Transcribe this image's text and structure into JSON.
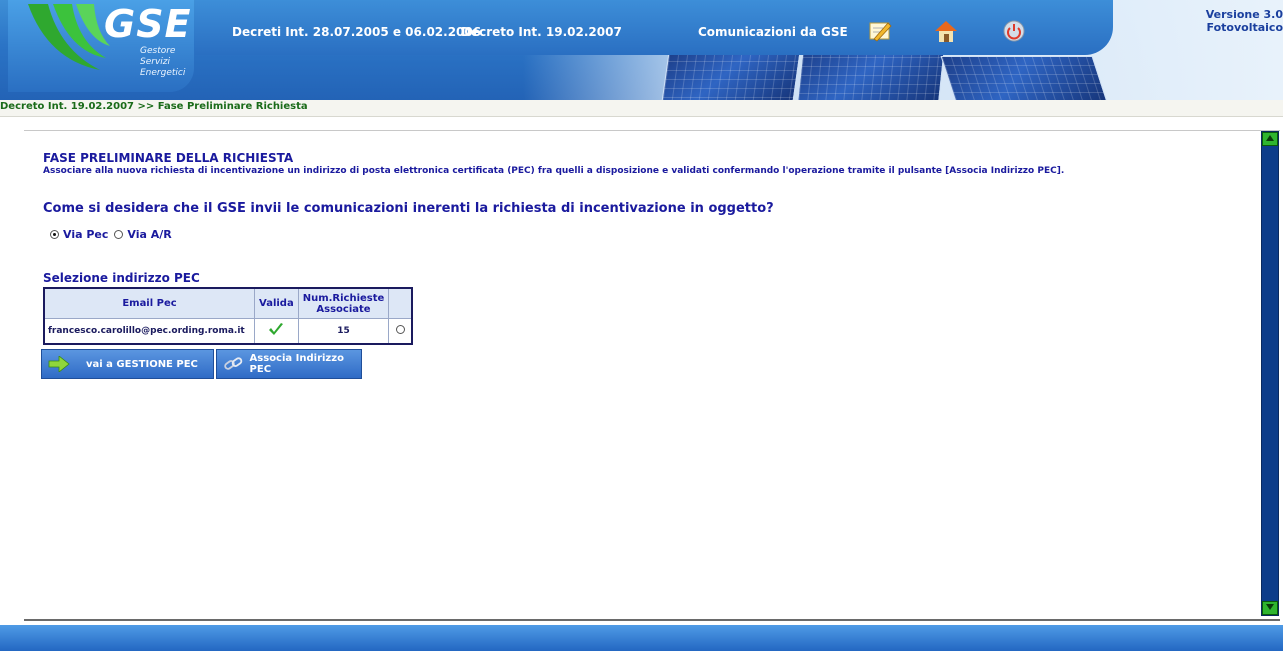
{
  "header": {
    "logo_text": "GSE",
    "logo_sub": [
      "Gestore",
      "Servizi",
      "Energetici"
    ],
    "nav": [
      {
        "label": "Decreti Int. 28.07.2005 e 06.02.2006"
      },
      {
        "label": "Decreto Int. 19.02.2007"
      },
      {
        "label": "Comunicazioni da GSE"
      }
    ],
    "icons": [
      "write-icon",
      "home-icon",
      "power-icon"
    ],
    "version": [
      "Versione 3.0",
      "Fotovoltaico"
    ]
  },
  "breadcrumb": "Decreto Int. 19.02.2007 >> Fase Preliminare Richiesta",
  "main": {
    "title": "FASE PRELIMINARE DELLA RICHIESTA",
    "description": "Associare alla nuova richiesta di incentivazione un indirizzo di posta elettronica certificata (PEC) fra quelli a disposizione e validati confermando l'operazione tramite il pulsante [Associa Indirizzo PEC].",
    "question": "Come si desidera che il GSE invii le comunicazioni inerenti la richiesta di incentivazione in oggetto?",
    "radios": [
      {
        "label": "Via Pec",
        "selected": true
      },
      {
        "label": "Via A/R",
        "selected": false
      }
    ],
    "section_title": "Selezione indirizzo PEC",
    "table": {
      "headers": [
        "Email Pec",
        "Valida",
        "Num.Richieste Associate",
        ""
      ],
      "rows": [
        {
          "email": "francesco.carolillo@pec.ording.roma.it",
          "valid_icon": "checkmark-icon",
          "count": "15",
          "selected": false
        }
      ]
    },
    "buttons": [
      {
        "label": "vai a GESTIONE PEC",
        "icon": "arrow-right-icon"
      },
      {
        "label": "Associa Indirizzo PEC",
        "icon": "link-icon"
      }
    ]
  },
  "colors": {
    "accent_blue": "#1a1a9e",
    "breadcrumb_green": "#1a6b1a",
    "header_blue": "#2b74c6",
    "check_green": "#2fa82f"
  }
}
